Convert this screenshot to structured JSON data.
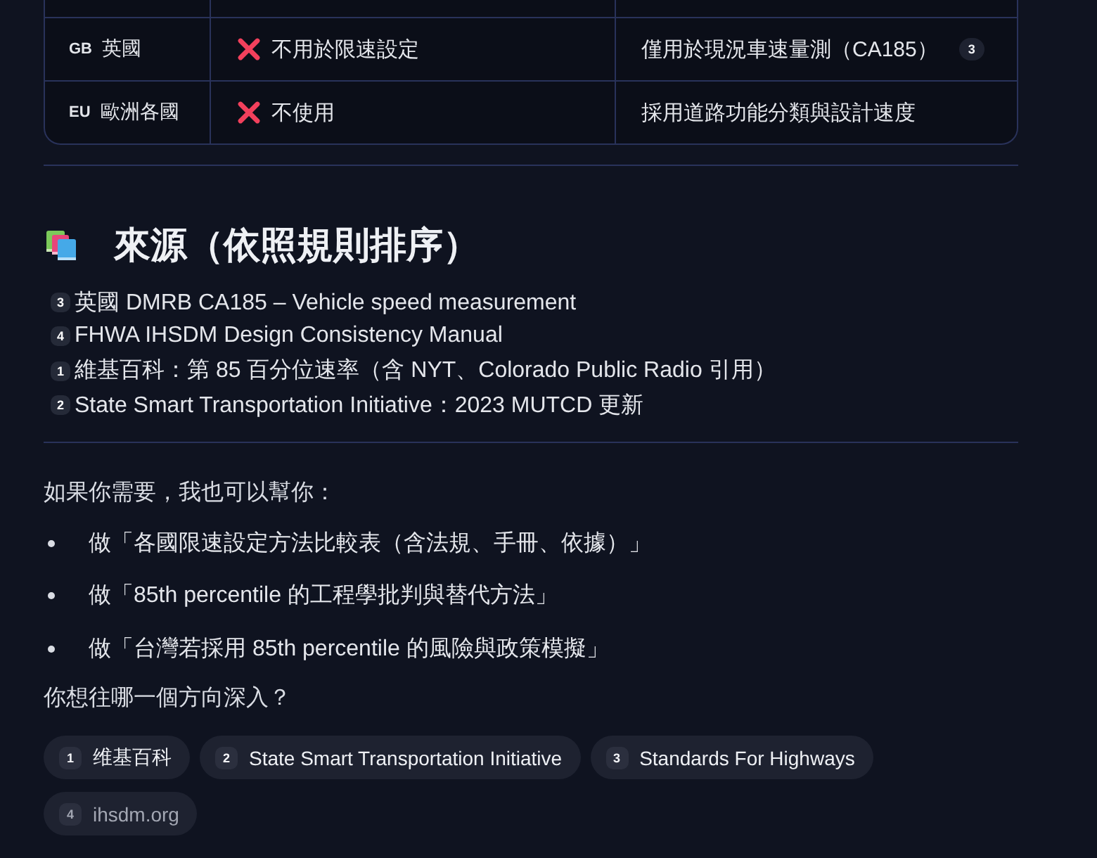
{
  "comparison_table": {
    "rows": [
      {
        "region": {
          "code": "GB",
          "name": "英國"
        },
        "usage": {
          "kind": "cross",
          "text": "不用於限速設定"
        },
        "note": {
          "text": "僅用於現況車速量測（CA185）",
          "citation": "3"
        }
      },
      {
        "region": {
          "code": "EU",
          "name": "歐洲各國"
        },
        "usage": {
          "kind": "cross",
          "text": "不使用"
        },
        "note": {
          "text": "採用道路功能分類與設計速度"
        }
      }
    ]
  },
  "sources": {
    "title": "來源（依照規則排序）",
    "items": [
      {
        "citation": "3",
        "text": "英國 DMRB CA185 – Vehicle speed measurement"
      },
      {
        "citation": "4",
        "text": "FHWA IHSDM Design Consistency Manual"
      },
      {
        "citation": "1",
        "text": "維基百科：第 85 百分位速率（含 NYT、Colorado Public Radio 引用）"
      },
      {
        "citation": "2",
        "text": "State Smart Transportation Initiative：2023 MUTCD 更新"
      }
    ]
  },
  "offer": {
    "intro": "如果你需要，我也可以幫你：",
    "items": [
      "做「各國限速設定方法比較表（含法規、手冊、依據）」",
      "做「85th percentile 的工程學批判與替代方法」",
      "做「台灣若採用 85th percentile 的風險與政策模擬」"
    ],
    "question": "你想往哪一個方向深入？"
  },
  "source_chips": [
    {
      "number": "1",
      "label": "维基百科",
      "dimmed": false
    },
    {
      "number": "2",
      "label": "State Smart Transportation Initiative",
      "dimmed": false
    },
    {
      "number": "3",
      "label": "Standards For Highways",
      "dimmed": false
    },
    {
      "number": "4",
      "label": "ihsdm.org",
      "dimmed": true
    }
  ]
}
